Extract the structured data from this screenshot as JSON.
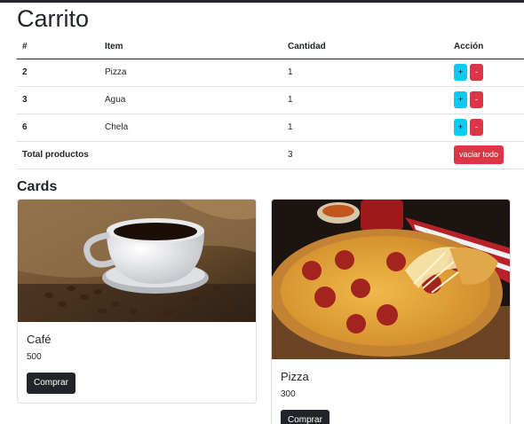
{
  "page": {
    "title": "Carrito",
    "cards_heading": "Cards"
  },
  "cart": {
    "headers": [
      "#",
      "Item",
      "Cantidad",
      "Acción"
    ],
    "rows": [
      {
        "id": "2",
        "item": "Pizza",
        "qty": "1"
      },
      {
        "id": "3",
        "item": "Agua",
        "qty": "1"
      },
      {
        "id": "6",
        "item": "Chela",
        "qty": "1"
      }
    ],
    "plus_label": "+",
    "minus_label": "-",
    "total_label": "Total productos",
    "total_value": "3",
    "empty_label": "vaciar todo"
  },
  "cards": [
    {
      "title": "Café",
      "price": "500",
      "button": "Comprar"
    },
    {
      "title": "Pizza",
      "price": "300",
      "button": "Comprar"
    }
  ],
  "colors": {
    "info": "#0dcaf0",
    "danger": "#dc3545",
    "dark": "#212529"
  }
}
